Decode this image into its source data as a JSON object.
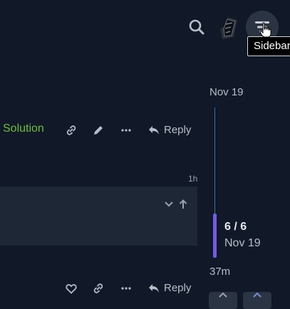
{
  "header": {
    "search_icon": "search-icon",
    "avatar_icon": "avatar",
    "sidebar_icon": "sidebar-toggle-icon",
    "tooltip": "Sidebar"
  },
  "post": {
    "solution_label": "Solution",
    "reply_label": "Reply",
    "icons": [
      "link-icon",
      "pencil-icon",
      "more-icon",
      "reply-icon"
    ]
  },
  "next_post": {
    "timestamp": "1h",
    "reply_label": "Reply",
    "icons": [
      "chevron-down-icon",
      "arrow-up-icon",
      "heart-icon",
      "link-icon",
      "more-icon",
      "reply-icon"
    ]
  },
  "timeline": {
    "top_date": "Nov 19",
    "position": "6 / 6",
    "position_date": "Nov 19",
    "bottom_label": "37m"
  },
  "colors": {
    "background": "#111827",
    "panel": "#1d2736",
    "accent_green": "#6bbf3a",
    "timeline_handle": "#6f5de6"
  }
}
